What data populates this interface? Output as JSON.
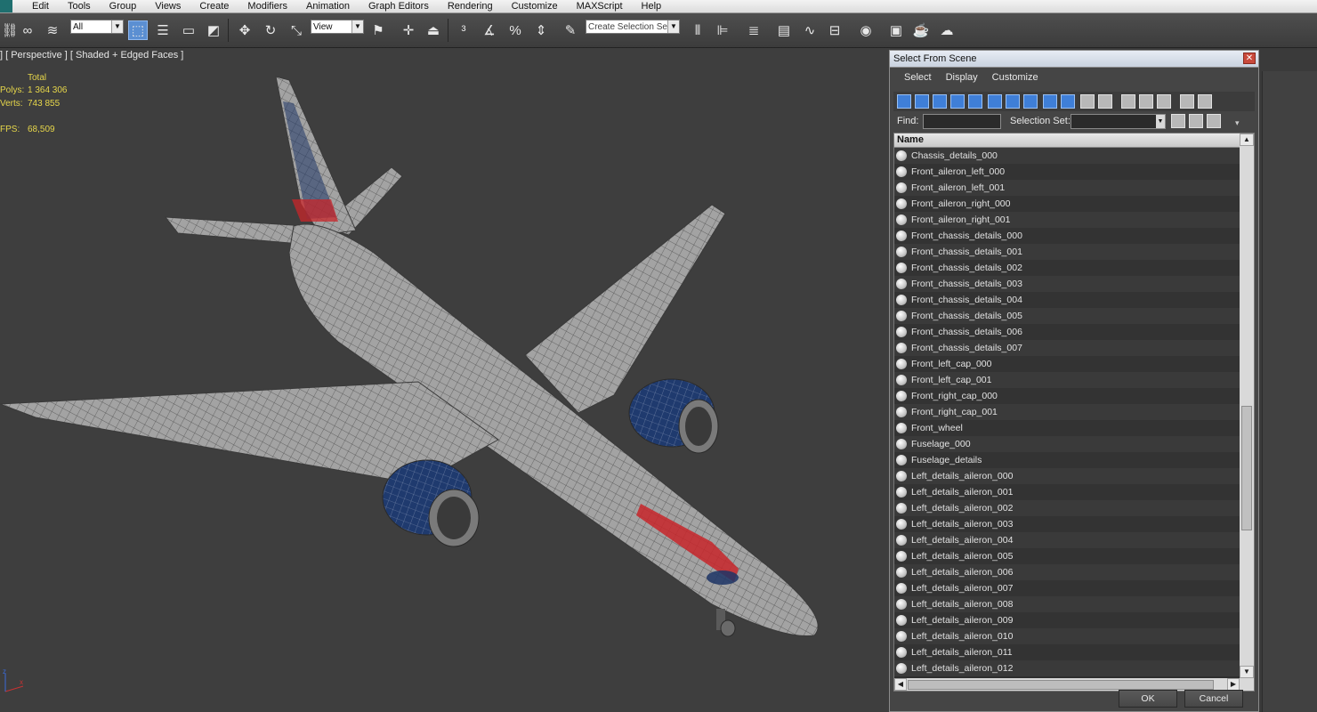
{
  "menu": [
    "Edit",
    "Tools",
    "Group",
    "Views",
    "Create",
    "Modifiers",
    "Animation",
    "Graph Editors",
    "Rendering",
    "Customize",
    "MAXScript",
    "Help"
  ],
  "toolbar": {
    "filter_value": "All",
    "coord_value": "View",
    "selection_set_placeholder": "Create Selection Se"
  },
  "viewport": {
    "label": "] [ Perspective ] [ Shaded + Edged Faces ]",
    "stats": {
      "header": "Total",
      "polys_label": "Polys:",
      "polys_value": "1 364 306",
      "verts_label": "Verts:",
      "verts_value": "743 855",
      "fps_label": "FPS:",
      "fps_value": "68,509"
    },
    "axis_labels": {
      "x": "x",
      "z": "z"
    }
  },
  "dialog": {
    "title": "Select From Scene",
    "menu": [
      "Select",
      "Display",
      "Customize"
    ],
    "find_label": "Find:",
    "find_value": "",
    "selection_set_label": "Selection Set:",
    "column_header": "Name",
    "items": [
      "Chassis_details_000",
      "Front_aileron_left_000",
      "Front_aileron_left_001",
      "Front_aileron_right_000",
      "Front_aileron_right_001",
      "Front_chassis_details_000",
      "Front_chassis_details_001",
      "Front_chassis_details_002",
      "Front_chassis_details_003",
      "Front_chassis_details_004",
      "Front_chassis_details_005",
      "Front_chassis_details_006",
      "Front_chassis_details_007",
      "Front_left_cap_000",
      "Front_left_cap_001",
      "Front_right_cap_000",
      "Front_right_cap_001",
      "Front_wheel",
      "Fuselage_000",
      "Fuselage_details",
      "Left_details_aileron_000",
      "Left_details_aileron_001",
      "Left_details_aileron_002",
      "Left_details_aileron_003",
      "Left_details_aileron_004",
      "Left_details_aileron_005",
      "Left_details_aileron_006",
      "Left_details_aileron_007",
      "Left_details_aileron_008",
      "Left_details_aileron_009",
      "Left_details_aileron_010",
      "Left_details_aileron_011",
      "Left_details_aileron_012"
    ],
    "ok_label": "OK",
    "cancel_label": "Cancel"
  },
  "colors": {
    "accent": "#5b8fd2",
    "stats_text": "#e6d64a",
    "plane_body": "#9c9c9c",
    "livery_red": "#c8262a",
    "engine_blue": "#1d3566"
  }
}
